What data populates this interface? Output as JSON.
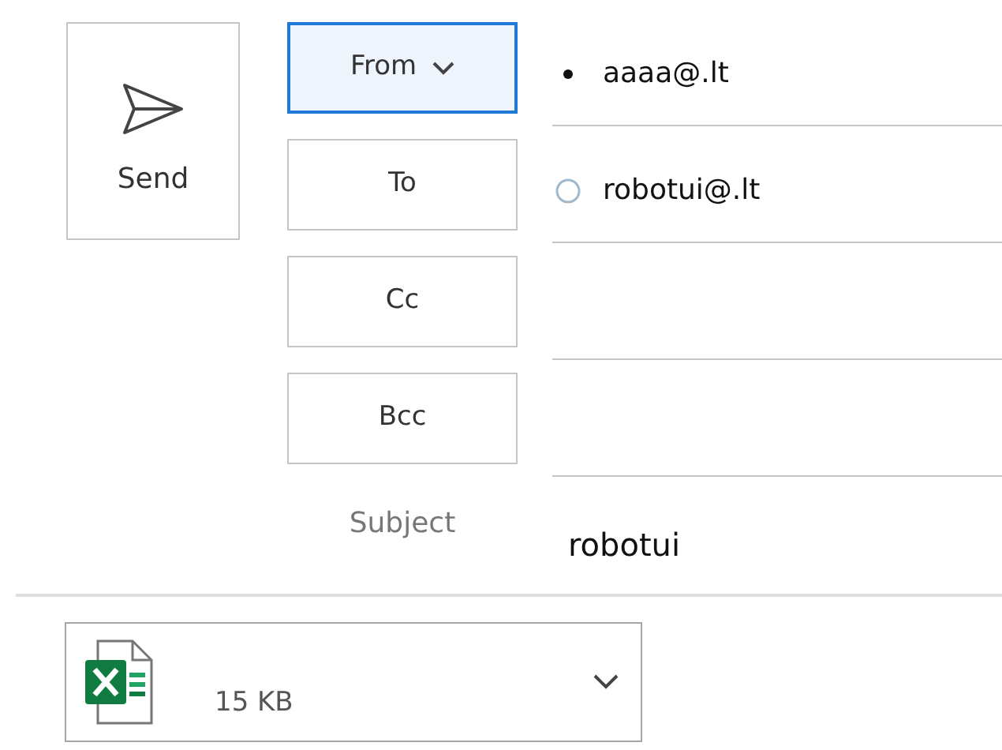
{
  "send_button": {
    "label": "Send"
  },
  "address_rows": [
    {
      "label": "From",
      "selected": true,
      "dropdown": true,
      "value": "aaaa@.lt",
      "kind": "dot"
    },
    {
      "label": "To",
      "selected": false,
      "dropdown": false,
      "value": "robotui@.lt",
      "kind": "ring"
    },
    {
      "label": "Cc",
      "selected": false,
      "dropdown": false,
      "kind": "plain"
    },
    {
      "label": "Bcc",
      "selected": false,
      "dropdown": false,
      "kind": "plain"
    }
  ],
  "subject": {
    "label": "Subject",
    "value": "robotui"
  },
  "attachment": {
    "size": "15 KB"
  }
}
